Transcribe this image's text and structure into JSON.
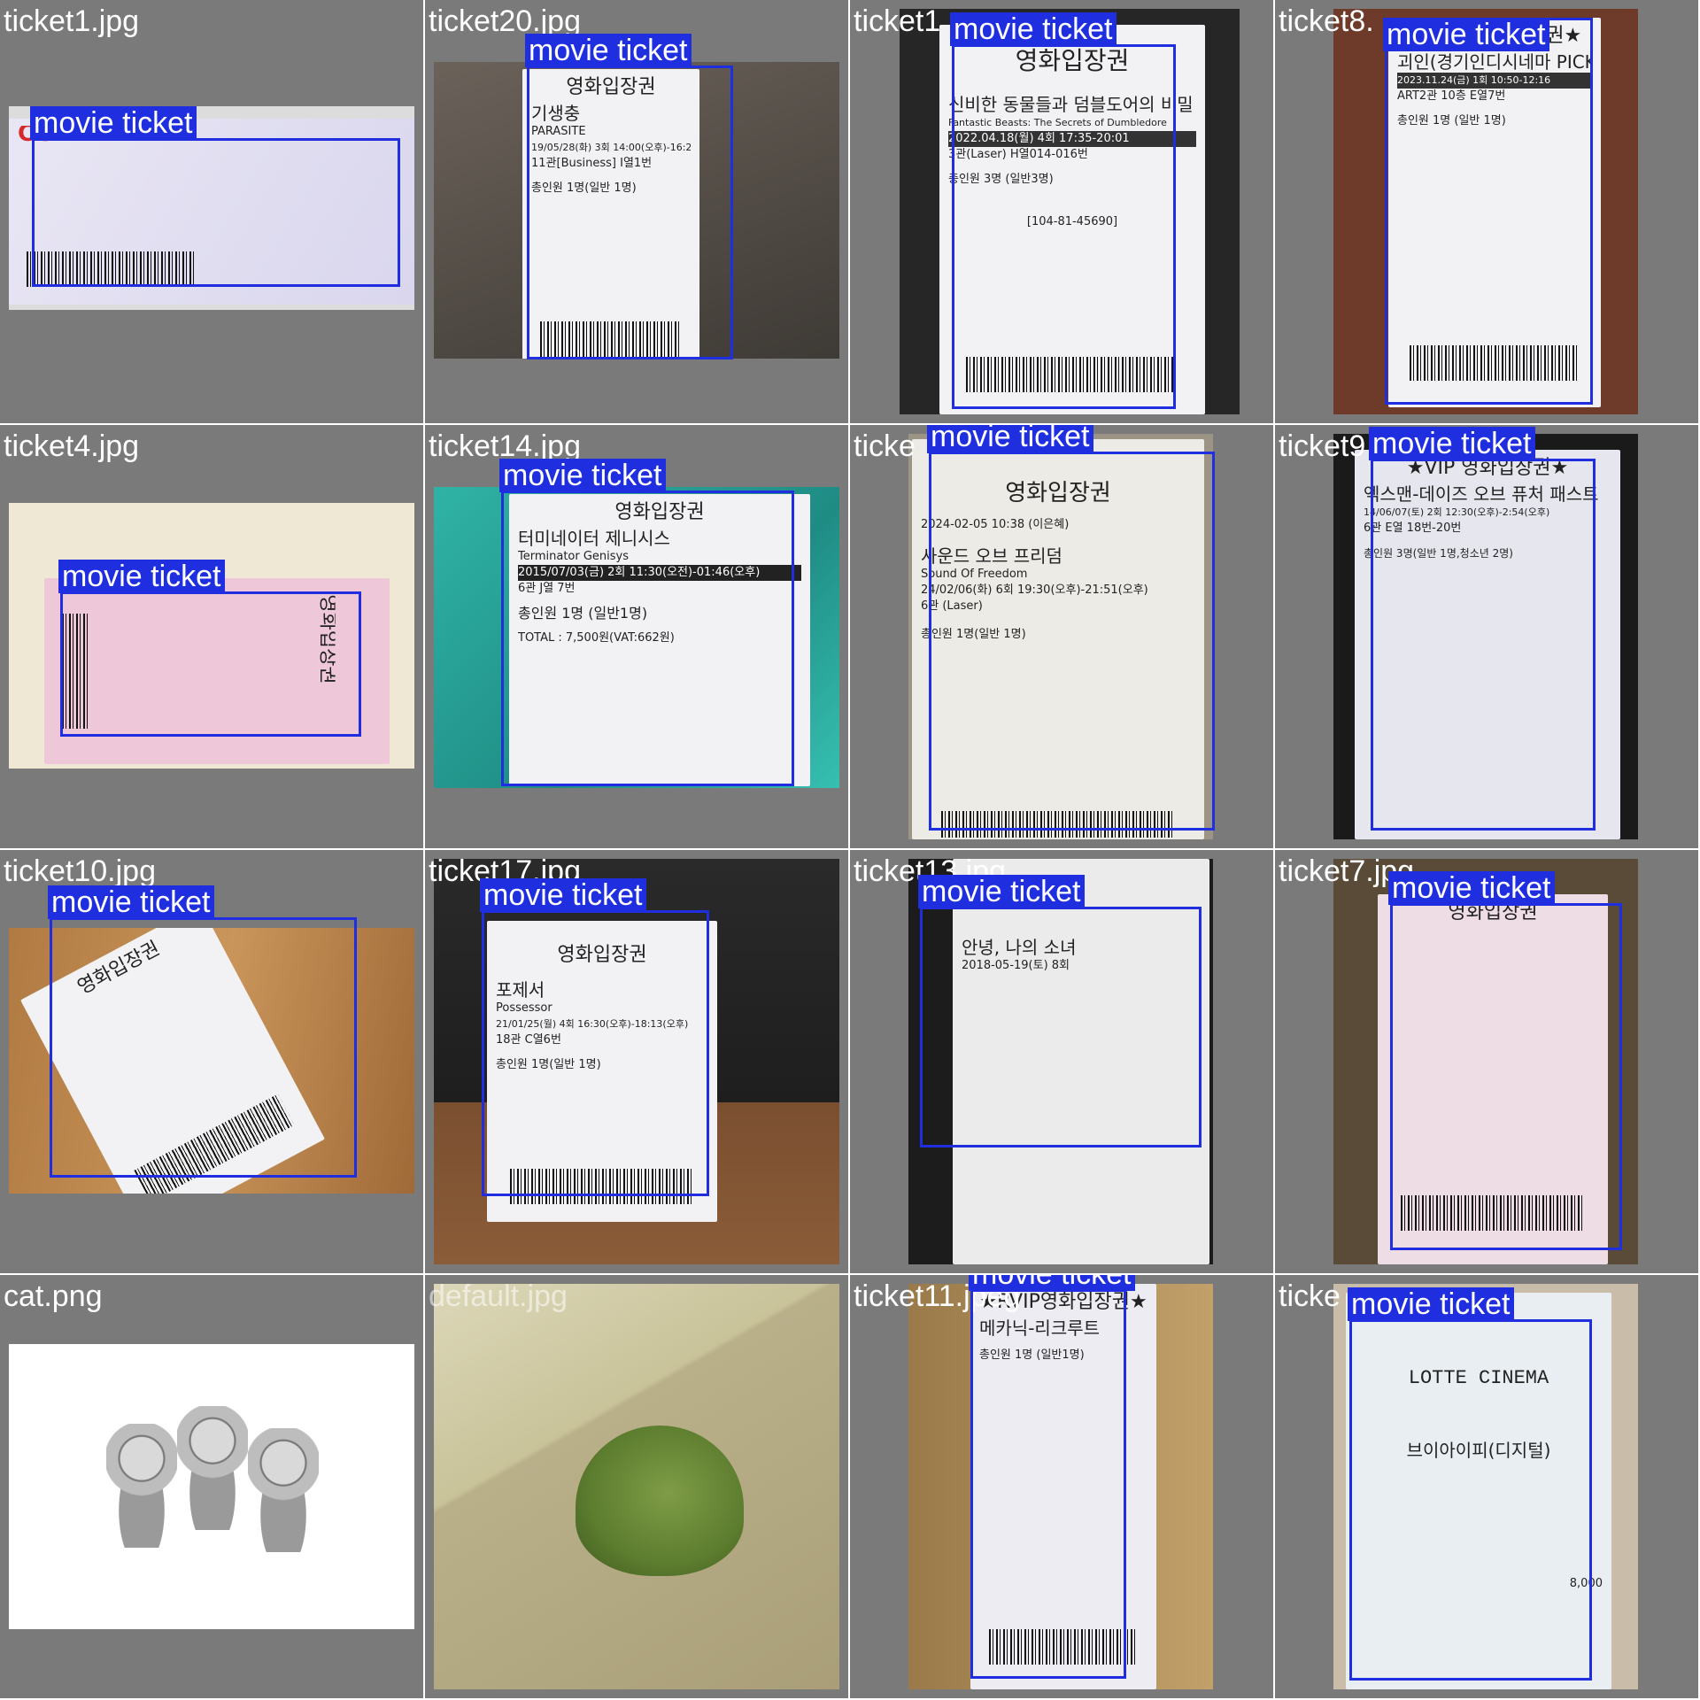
{
  "grid": {
    "cells": [
      {
        "file": "ticket1.jpg",
        "label": "movie ticket",
        "has_box": true
      },
      {
        "file": "ticket20.jpg",
        "label": "movie ticket",
        "has_box": true
      },
      {
        "file": "ticket1",
        "label": "movie ticket",
        "has_box": true
      },
      {
        "file": "ticket8.",
        "label": "movie ticket",
        "has_box": true
      },
      {
        "file": "ticket4.jpg",
        "label": "movie ticket",
        "has_box": true
      },
      {
        "file": "ticket14.jpg",
        "label": "movie ticket",
        "has_box": true
      },
      {
        "file": "ticke",
        "label": "movie ticket",
        "has_box": true
      },
      {
        "file": "ticket9",
        "label": "movie ticket",
        "has_box": true
      },
      {
        "file": "ticket10.jpg",
        "label": "movie ticket",
        "has_box": true
      },
      {
        "file": "ticket17.jpg",
        "label": "movie ticket",
        "has_box": true
      },
      {
        "file": "ticket13.jpg",
        "label": "movie ticket",
        "has_box": true
      },
      {
        "file": "ticket7.jpg",
        "label": "movie ticket",
        "has_box": true
      },
      {
        "file": "cat.png",
        "label": "",
        "has_box": false
      },
      {
        "file": "default.jpg",
        "label": "",
        "has_box": false
      },
      {
        "file": "ticket11.jpeg",
        "label": "movie ticket",
        "has_box": true
      },
      {
        "file": "ticke",
        "label": "movie ticket",
        "has_box": true
      }
    ]
  },
  "tickets": {
    "t20": {
      "header": "영화입장권",
      "title": "기생충",
      "sub": "PARASITE",
      "time": "19/05/28(화) 3회 14:00(오후)-16:21(오후)",
      "seat": "11관[Business] I열1번",
      "people": "총인원 1명(일반 1명)"
    },
    "t1b": {
      "header": "영화입장권",
      "title": "신비한 동물들과 덤블도어의 비밀",
      "sub": "Fantastic Beasts: The Secrets of Dumbledore",
      "time": "2022.04.18(월) 4회 17:35-20:01",
      "seat": "3관(Laser) H열014-016번",
      "people": "총인원 3명 (일반3명)",
      "code": "[104-81-45690]"
    },
    "t8": {
      "header": "★RVIP 영화입장권★",
      "title": "괴인(경기인디시네마 PICK)",
      "time": "2023.11.24(금) 1회 10:50-12:16",
      "seat": "ART2관 10층 E열7번",
      "people": "총인원 1명 (일반 1명)"
    },
    "t4": {
      "header": "영화입장권"
    },
    "t14": {
      "header": "영화입장권",
      "title": "터미네이터 제니시스",
      "sub": "Terminator Genisys",
      "time": "2015/07/03(금) 2회 11:30(오전)-01:46(오후)",
      "seat": "6관 J열 7번",
      "people": "총인원 1명 (일반1명)",
      "total": "TOTAL : 7,500원(VAT:662원)"
    },
    "t6": {
      "header": "영화입장권",
      "date": "2024-02-05 10:38 (이은혜)",
      "title": "사운드 오브 프리덤",
      "sub": "Sound Of Freedom",
      "time": "24/02/06(화) 6회 19:30(오후)-21:51(오후)",
      "seat": "6관 (Laser)",
      "people": "총인원 1명(일반 1명)"
    },
    "t9": {
      "header": "★VIP 영화입장권★",
      "title": "엑스맨-데이즈 오브 퓨처 패스트",
      "time": "14/06/07(토) 2회 12:30(오후)-2:54(오후)",
      "seat": "6관 E열 18번-20번",
      "people": "총인원 3명(일반 1명,청소년 2명)"
    },
    "t10": {
      "header": "영화입장권"
    },
    "t17": {
      "header": "영화입장권",
      "title": "포제서",
      "sub": "Possessor",
      "time": "21/01/25(월) 4회 16:30(오후)-18:13(오후)",
      "seat": "18관 C열6번",
      "people": "총인원 1명(일반 1명)"
    },
    "t13": {
      "title": "안녕, 나의 소녀",
      "time": "2018-05-19(토) 8회"
    },
    "t7": {
      "header": "영화입장권"
    },
    "t11": {
      "header": "★RVIP영화입장권★",
      "title": "메카닉-리크루트",
      "people": "총인원 1명 (일반1명)"
    },
    "tl": {
      "header": "LOTTE CINEMA",
      "title": "브이아이피(디지털)",
      "total": "8,000"
    }
  },
  "colors": {
    "cell_bg": "#7a7a7a",
    "box_blue": "#1f2fe0",
    "label_text": "#ffffff"
  }
}
